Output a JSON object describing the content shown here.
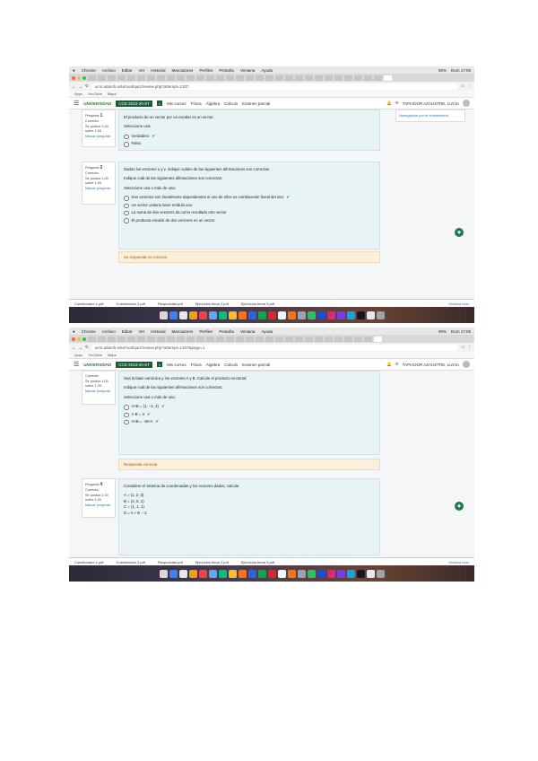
{
  "menubar": {
    "items": [
      "Chrome",
      "Archivo",
      "Editar",
      "Ver",
      "Historial",
      "Marcadores",
      "Perfiles",
      "Pestaña",
      "Ventana",
      "Ayuda"
    ],
    "status": [
      "90%",
      "Dom 17:05"
    ]
  },
  "browser": {
    "url_1": "ucm.adarsh.edu/mod/quiz/review.php?attempt=1207",
    "url_2": "ucm.adarsh.edu/mod/quiz/review.php?attempt=1207&page=1",
    "bookmarks": [
      "Apps",
      "YouTube",
      "Maps"
    ]
  },
  "site": {
    "menu_icon": "☰",
    "logo": "UNIVERSIDAD",
    "course": "CCE-2023-20-ST",
    "breadcrumb": [
      "Mis cursos",
      "Física",
      "Álgebra",
      "Cálculo",
      "Examen parcial"
    ],
    "user_name": "TAPIADOR AZAUSTRE, LUCIA"
  },
  "shot1": {
    "qinfo_a": {
      "label": "Pregunta",
      "number": "1",
      "status": "Correcta",
      "score": "Se puntúa 1,00 sobre 1,00",
      "flag": "Marcar pregunta"
    },
    "q1_text": "El producto de un vector por un escalar es un vector.",
    "q1_prompt": "Seleccione una:",
    "q1_options": [
      "Verdadero",
      "Falso"
    ],
    "qinfo_b": {
      "label": "Pregunta",
      "number": "2",
      "status": "Correcta",
      "score": "Se puntúa 1,00 sobre 1,00",
      "flag": "Marcar pregunta"
    },
    "q2_text": "Dados los vectores u y v, indique cuáles de las siguientes afirmaciones son correctas.",
    "q2_instruction": "Indique cuál de las siguientes afirmaciones son correctas:",
    "q2_prompt": "Seleccione una o más de una:",
    "q2_options": [
      "Dos vectores son linealmente dependientes si uno de ellos es combinación lineal del otro",
      "Un vector unitario tiene módulo uno",
      "La suma de dos vectores da como resultado otro vector",
      "El producto escalar de dos vectores es un vector"
    ],
    "feedback": "Su respuesta es correcta.",
    "nav_link": "Navegación por el cuestionario"
  },
  "shot2": {
    "q_text": "Sea la base canónica y los vectores A y B. Calcule el producto vectorial:",
    "q_instruction": "Indique cuál de las siguientes afirmaciones son correctas:",
    "q_prompt": "Seleccione una o más de una:",
    "q_options": [
      "A×B = (1, −1, 2)",
      "A·B = 3",
      "A×B = −B×A"
    ],
    "feedback": "Respuesta correcta",
    "qinfo": {
      "label": "Pregunta",
      "number": "4",
      "status": "Correcta",
      "score": "Se puntúa 1,00 sobre 1,00",
      "flag": "Marcar pregunta"
    },
    "q4_text": "Considere el sistema de coordenadas y los vectores dados, calcule:",
    "q4_lines": [
      "A = (1, 2, 3)",
      "B = (2, 0, 1)",
      "C = (1, 1, 1)",
      "D = A + B − C"
    ]
  },
  "downloads": {
    "items": [
      "Cuestionario 1.pdf",
      "Cuestionario 2.pdf",
      "Respuestas.pdf",
      "Ejercicios tema 2.pdf",
      "Ejercicios tema 3.pdf"
    ],
    "show_all": "Mostrar todo"
  },
  "icons": {
    "check": "✔",
    "fab": "◆"
  },
  "colors": {
    "accent_green": "#1a5c38",
    "feedback_bg": "#fcefdc",
    "question_bg": "#e7f3f5"
  }
}
